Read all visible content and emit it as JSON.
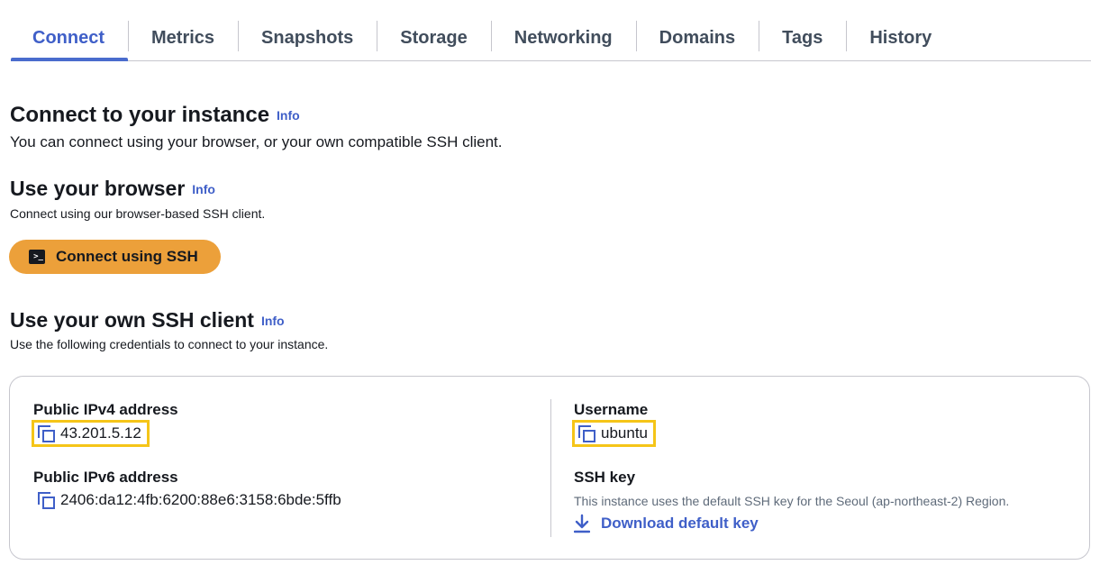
{
  "tabs": [
    {
      "label": "Connect",
      "active": true
    },
    {
      "label": "Metrics",
      "active": false
    },
    {
      "label": "Snapshots",
      "active": false
    },
    {
      "label": "Storage",
      "active": false
    },
    {
      "label": "Networking",
      "active": false
    },
    {
      "label": "Domains",
      "active": false
    },
    {
      "label": "Tags",
      "active": false
    },
    {
      "label": "History",
      "active": false
    }
  ],
  "connect": {
    "title": "Connect to your instance",
    "info": "Info",
    "description": "You can connect using your browser, or your own compatible SSH client."
  },
  "browser": {
    "title": "Use your browser",
    "info": "Info",
    "description": "Connect using our browser-based SSH client.",
    "button_label": "Connect using SSH",
    "button_icon": "terminal-icon",
    "button_color": "#eca03a"
  },
  "ssh_client": {
    "title": "Use your own SSH client",
    "info": "Info",
    "description": "Use the following credentials to connect to your instance.",
    "ipv4_label": "Public IPv4 address",
    "ipv4_value": "43.201.5.12",
    "ipv6_label": "Public IPv6 address",
    "ipv6_value": "2406:da12:4fb:6200:88e6:3158:6bde:5ffb",
    "username_label": "Username",
    "username_value": "ubuntu",
    "ssh_key_label": "SSH key",
    "ssh_key_note": "This instance uses the default SSH key for the Seoul (ap-northeast-2) Region.",
    "download_label": "Download default key",
    "copy_icon": "copy-icon",
    "download_icon": "download-icon"
  },
  "colors": {
    "accent": "#3f5fc8",
    "highlight": "#f5c518"
  }
}
